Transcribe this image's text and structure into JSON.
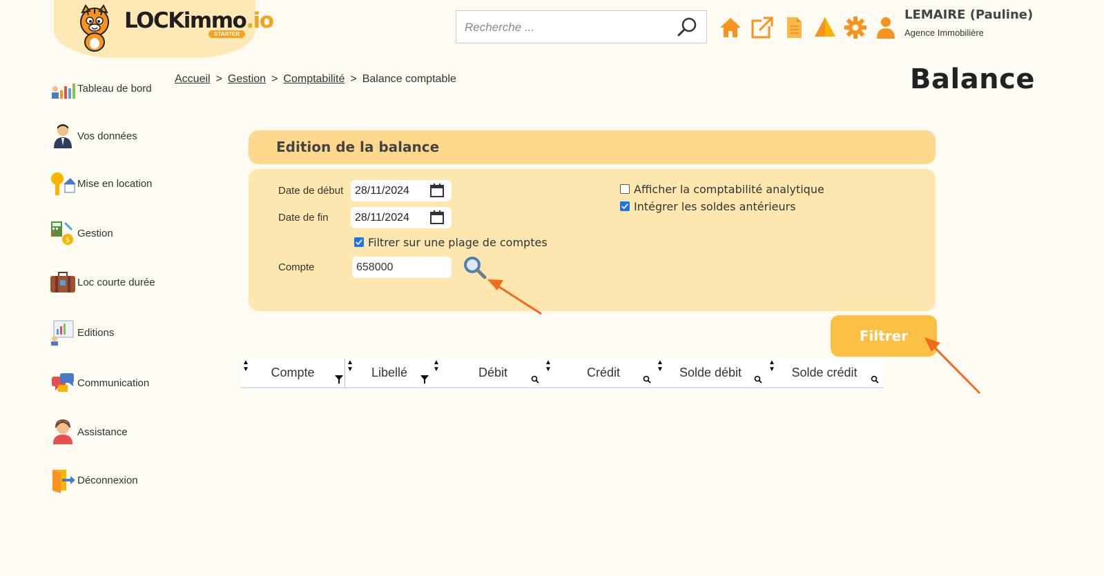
{
  "header": {
    "logo": {
      "text_main": "LOCKimmo",
      "text_suffix": ".io",
      "badge": "STARTER"
    },
    "search": {
      "placeholder": "Recherche ..."
    },
    "icons": [
      "home-icon",
      "external-link-icon",
      "document-icon",
      "alert-icon",
      "gear-icon",
      "user-icon"
    ],
    "user": {
      "name": "LEMAIRE (Pauline)",
      "role": "Agence Immobilière"
    }
  },
  "sidebar": {
    "items": [
      {
        "label": "Tableau de bord",
        "icon": "dashboard-icon"
      },
      {
        "label": "Vos données",
        "icon": "person-icon"
      },
      {
        "label": "Mise en location",
        "icon": "key-house-icon"
      },
      {
        "label": "Gestion",
        "icon": "calculator-icon"
      },
      {
        "label": "Loc courte durée",
        "icon": "suitcase-icon"
      },
      {
        "label": "Editions",
        "icon": "report-icon"
      },
      {
        "label": "Communication",
        "icon": "chat-icon"
      },
      {
        "label": "Assistance",
        "icon": "support-agent-icon"
      },
      {
        "label": "Déconnexion",
        "icon": "logout-icon"
      }
    ]
  },
  "breadcrumb": {
    "items": [
      "Accueil",
      "Gestion",
      "Comptabilité"
    ],
    "current": "Balance comptable",
    "separator": ">"
  },
  "page_title": "Balance",
  "panel": {
    "title": "Edition de la balance",
    "date_debut_label": "Date de début",
    "date_debut_value": "28/11/2024",
    "date_fin_label": "Date de fin",
    "date_fin_value": "28/11/2024",
    "filtrer_plage_label": "Filtrer sur une plage de comptes",
    "filtrer_plage_checked": true,
    "compte_label": "Compte",
    "compte_value": "658000",
    "analytique_label": "Afficher la comptabilité analytique",
    "analytique_checked": false,
    "soldes_label": "Intégrer les soldes antérieurs",
    "soldes_checked": true
  },
  "filter_button": {
    "label": "Filtrer"
  },
  "table": {
    "columns": [
      "Compte",
      "Libellé",
      "Débit",
      "Crédit",
      "Solde débit",
      "Solde crédit"
    ]
  },
  "colors": {
    "background": "#fdfaf1",
    "panel_header": "#fdd98d",
    "panel_body": "#fde7af",
    "accent_orange": "#f7931e",
    "button": "#fbc043",
    "annotation_arrow": "#f26a1b"
  }
}
